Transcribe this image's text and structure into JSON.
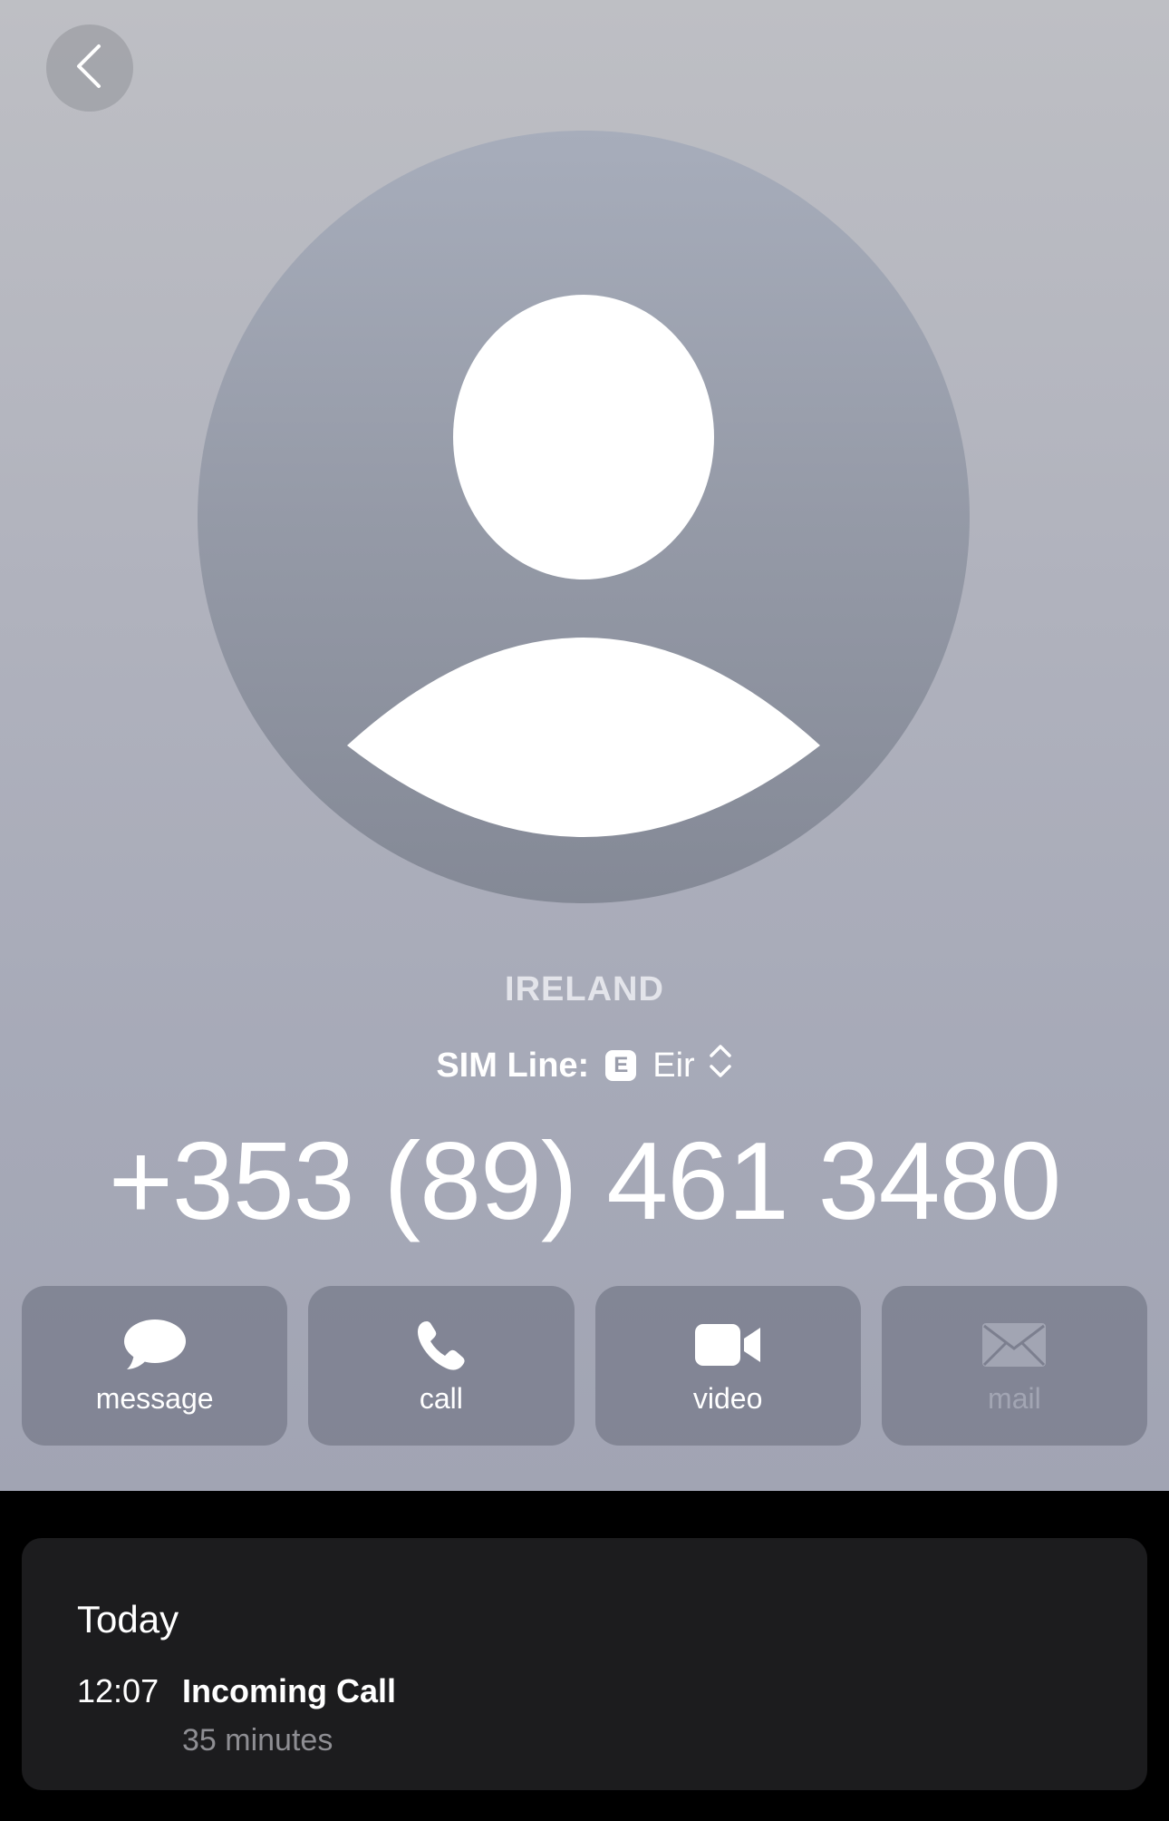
{
  "header": {
    "country": "IRELAND",
    "sim_label": "SIM Line:",
    "sim_badge": "E",
    "sim_carrier": "Eir",
    "phone_number": "+353 (89) 461 3480"
  },
  "actions": [
    {
      "label": "message",
      "icon": "message-bubble-icon",
      "enabled": true
    },
    {
      "label": "call",
      "icon": "phone-icon",
      "enabled": true
    },
    {
      "label": "video",
      "icon": "video-camera-icon",
      "enabled": true
    },
    {
      "label": "mail",
      "icon": "envelope-icon",
      "enabled": false
    }
  ],
  "history": {
    "day": "Today",
    "entries": [
      {
        "time": "12:07",
        "type": "Incoming Call",
        "duration": "35 minutes"
      }
    ]
  },
  "colors": {
    "background_top": "#bebfc4",
    "avatar": "#959aa7",
    "action_button": "#7c7f8f",
    "history_card": "#1c1c1e",
    "secondary_text": "#8e8e93"
  }
}
